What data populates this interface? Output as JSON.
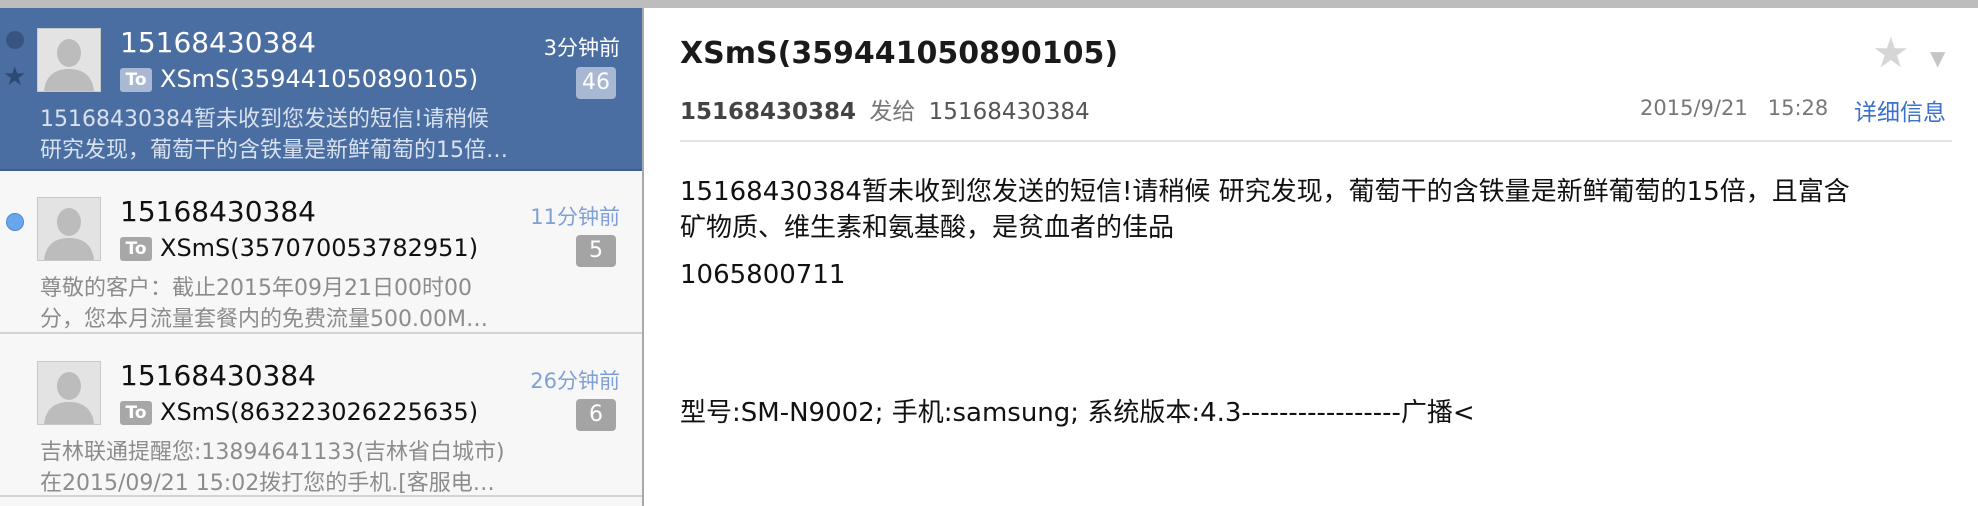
{
  "messages": [
    {
      "sender": "15168430384",
      "time": "3分钟前",
      "to_label": "To",
      "recipient": "XSmS(359441050890105)",
      "count": "46",
      "preview_line1": "15168430384暂未收到您发送的短信!请稍候",
      "preview_line2": "研究发现，葡萄干的含铁量是新鲜葡萄的15倍…"
    },
    {
      "sender": "15168430384",
      "time": "11分钟前",
      "to_label": "To",
      "recipient": "XSmS(357070053782951)",
      "count": "5",
      "preview_line1": "尊敬的客户：截止2015年09月21日00时00",
      "preview_line2": "分，您本月流量套餐内的免费流量500.00M…"
    },
    {
      "sender": "15168430384",
      "time": "26分钟前",
      "to_label": "To",
      "recipient": "XSmS(863223026225635)",
      "count": "6",
      "preview_line1": "吉林联通提醒您:13894641133(吉林省白城市)",
      "preview_line2": "在2015/09/21 15:02拨打您的手机.[客服电…"
    }
  ],
  "detail": {
    "subject": "XSmS(359441050890105)",
    "from": "15168430384",
    "sent_to_label": "发给",
    "to": "15168430384",
    "date": "2015/9/21",
    "time": "15:28",
    "details_link": "详细信息",
    "body_line1": "15168430384暂未收到您发送的短信!请稍候 研究发现，葡萄干的含铁量是新鲜葡萄的15倍，且富含",
    "body_line2": "矿物质、维生素和氨基酸，是贫血者的佳品",
    "body_line3": "1065800711",
    "body_line4": "型号:SM-N9002; 手机:samsung; 系统版本:4.3-----------------广播<"
  },
  "icons": {
    "star": "star-icon",
    "unread": "unread-dot-icon",
    "avatar": "person-avatar-icon",
    "menu": "chevron-down-icon"
  },
  "colors": {
    "selected_row": "#4b6ea2",
    "unread_dot": "#6aa6ec",
    "link": "#3a72c8",
    "time_label": "#7fa0d4"
  }
}
